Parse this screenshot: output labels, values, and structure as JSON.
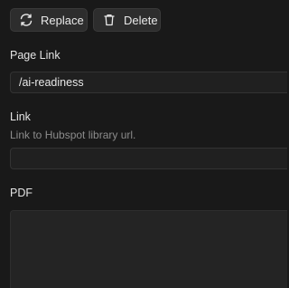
{
  "toolbar": {
    "replace_label": "Replace",
    "replace_icon": "refresh-icon",
    "delete_label": "Delete",
    "delete_icon": "trash-icon"
  },
  "page_link": {
    "label": "Page Link",
    "value": "/ai-readiness"
  },
  "link": {
    "label": "Link",
    "help": "Link to Hubspot library url.",
    "value": ""
  },
  "pdf": {
    "label": "PDF"
  }
}
